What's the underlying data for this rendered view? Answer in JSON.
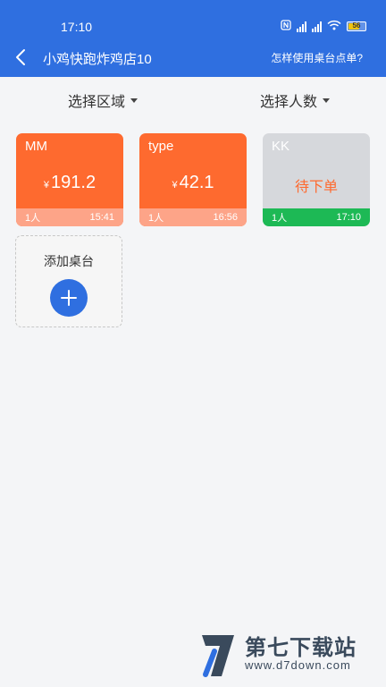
{
  "status_bar": {
    "time": "17:10",
    "battery": "56"
  },
  "nav": {
    "title": "小鸡快跑炸鸡店10",
    "help_link": "怎样使用桌台点单?"
  },
  "filters": {
    "area": "选择区域",
    "people": "选择人数"
  },
  "tables": [
    {
      "name": "MM",
      "currency": "¥",
      "amount": "191.2",
      "people": "1人",
      "time": "15:41",
      "color": "#fe6a2f",
      "footer_color": "#fda488"
    },
    {
      "name": "type",
      "currency": "¥",
      "amount": "42.1",
      "people": "1人",
      "time": "16:56",
      "color": "#fe6a2f",
      "footer_color": "#fda488"
    },
    {
      "name": "KK",
      "status": "待下单",
      "people": "1人",
      "time": "17:10",
      "color": "#d6d8dc",
      "footer_color": "#1db955",
      "status_color": "#fe6a2f"
    }
  ],
  "add_table": {
    "label": "添加桌台"
  },
  "watermark": {
    "text": "第七下载站",
    "url": "www.d7down.com"
  }
}
